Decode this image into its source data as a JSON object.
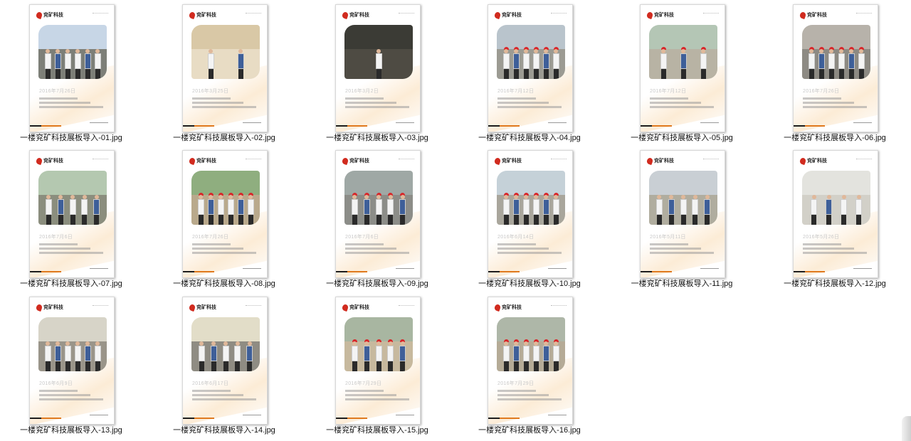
{
  "files": [
    {
      "name": "一楼兖矿科技展板导入-01.jpg",
      "date": "2016年7月26日",
      "sky": "#c7d6e6",
      "ground": "#7d7f78",
      "people": 6,
      "hats": false
    },
    {
      "name": "一楼兖矿科技展板导入-02.jpg",
      "date": "2016年3月25日",
      "sky": "#d9c8a6",
      "ground": "#e8dcc4",
      "people": 2,
      "hats": false
    },
    {
      "name": "一楼兖矿科技展板导入-03.jpg",
      "date": "2016年3月2日",
      "sky": "#3b3b35",
      "ground": "#4e4b43",
      "people": 1,
      "hats": false
    },
    {
      "name": "一楼兖矿科技展板导入-04.jpg",
      "date": "2016年7月12日",
      "sky": "#b9c4cc",
      "ground": "#9c9b93",
      "people": 6,
      "hats": true
    },
    {
      "name": "一楼兖矿科技展板导入-05.jpg",
      "date": "2016年7月12日",
      "sky": "#b4c6b5",
      "ground": "#b8b3a4",
      "people": 3,
      "hats": true
    },
    {
      "name": "一楼兖矿科技展板导入-06.jpg",
      "date": "2016年7月26日",
      "sky": "#b7b2aa",
      "ground": "#8d8a83",
      "people": 6,
      "hats": true
    },
    {
      "name": "一楼兖矿科技展板导入-07.jpg",
      "date": "2016年7月6日",
      "sky": "#b4c8b0",
      "ground": "#8b8e7e",
      "people": 5,
      "hats": false
    },
    {
      "name": "一楼兖矿科技展板导入-08.jpg",
      "date": "2016年7月26日",
      "sky": "#8fae7f",
      "ground": "#b9a98c",
      "people": 6,
      "hats": true
    },
    {
      "name": "一楼兖矿科技展板导入-09.jpg",
      "date": "2016年7月6日",
      "sky": "#9fa8a5",
      "ground": "#8c8d88",
      "people": 5,
      "hats": true
    },
    {
      "name": "一楼兖矿科技展板导入-10.jpg",
      "date": "2016年6月14日",
      "sky": "#c5d1d8",
      "ground": "#a9a69c",
      "people": 6,
      "hats": true
    },
    {
      "name": "一楼兖矿科技展板导入-11.jpg",
      "date": "2016年5月11日",
      "sky": "#c9cfd4",
      "ground": "#b0ad9f",
      "people": 5,
      "hats": false
    },
    {
      "name": "一楼兖矿科技展板导入-12.jpg",
      "date": "2016年5月26日",
      "sky": "#e3e3de",
      "ground": "#d2d0c8",
      "people": 4,
      "hats": false
    },
    {
      "name": "一楼兖矿科技展板导入-13.jpg",
      "date": "2016年6月9日",
      "sky": "#d7d4c8",
      "ground": "#9a958a",
      "people": 6,
      "hats": false
    },
    {
      "name": "一楼兖矿科技展板导入-14.jpg",
      "date": "2016年6月17日",
      "sky": "#e2ddc8",
      "ground": "#8f8c83",
      "people": 5,
      "hats": false
    },
    {
      "name": "一楼兖矿科技展板导入-15.jpg",
      "date": "2016年7月29日",
      "sky": "#a8b6a1",
      "ground": "#c7b99e",
      "people": 5,
      "hats": true
    },
    {
      "name": "一楼兖矿科技展板导入-16.jpg",
      "date": "2016年7月29日",
      "sky": "#aeb7a8",
      "ground": "#b5ab97",
      "people": 6,
      "hats": true
    }
  ],
  "logo_text": "兖矿科技"
}
